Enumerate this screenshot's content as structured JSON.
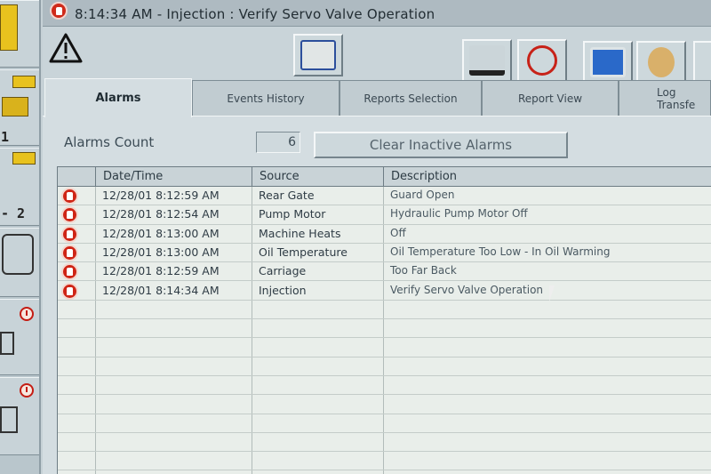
{
  "title_bar": {
    "text": "8:14:34 AM - Injection : Verify Servo Valve Operation"
  },
  "left_panel": {
    "numbers": [
      "1",
      "- 2"
    ]
  },
  "toolbar": {
    "icons": [
      "warning-icon",
      "camera-icon",
      "machine-settings-icon",
      "mute-icon",
      "film-icon",
      "users-icon"
    ]
  },
  "tabs": [
    {
      "label": "Alarms",
      "active": true
    },
    {
      "label": "Events History",
      "active": false
    },
    {
      "label": "Reports Selection",
      "active": false
    },
    {
      "label": "Report View",
      "active": false
    },
    {
      "label": "Log Transfe",
      "active": false
    }
  ],
  "alarms": {
    "count_label": "Alarms Count",
    "count_value": "6",
    "clear_button": "Clear Inactive Alarms",
    "columns": [
      "Date/Time",
      "Source",
      "Description"
    ],
    "rows": [
      {
        "datetime": "12/28/01 8:12:59 AM",
        "source": "Rear Gate",
        "description": "Guard Open"
      },
      {
        "datetime": "12/28/01 8:12:54 AM",
        "source": "Pump Motor",
        "description": "Hydraulic Pump Motor Off"
      },
      {
        "datetime": "12/28/01 8:13:00 AM",
        "source": "Machine Heats",
        "description": "Off"
      },
      {
        "datetime": "12/28/01 8:13:00 AM",
        "source": "Oil Temperature",
        "description": "Oil Temperature Too Low - In Oil Warming"
      },
      {
        "datetime": "12/28/01 8:12:59 AM",
        "source": "Carriage",
        "description": "Too Far Back"
      },
      {
        "datetime": "12/28/01 8:14:34 AM",
        "source": "Injection",
        "description": "Verify Servo Valve Operation"
      }
    ]
  },
  "colors": {
    "alarm_red": "#cf2415",
    "panel_bg": "#d4dde1",
    "grid_bg": "#e9eeea"
  }
}
